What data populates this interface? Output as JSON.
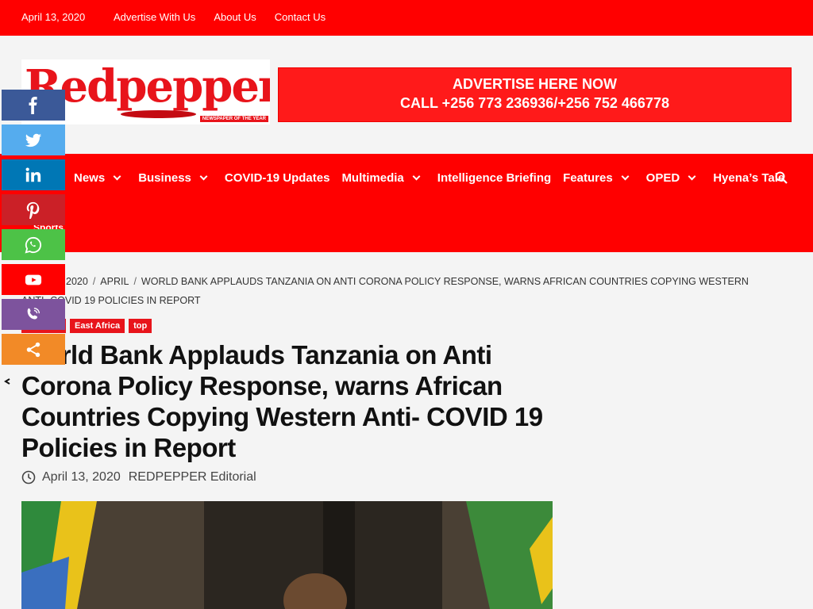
{
  "topbar": {
    "date": "April 13, 2020",
    "links": [
      "Advertise With Us",
      "About Us",
      "Contact Us"
    ]
  },
  "header": {
    "logo_text": "Redpepper",
    "logo_tagline": "NEWSPAPER OF THE YEAR",
    "ad_line1": "ADVERTISE HERE NOW",
    "ad_line2": "CALL +256 773 236936/+256 752 466778"
  },
  "nav": {
    "items": [
      {
        "label": "News",
        "dropdown": true
      },
      {
        "label": "Business",
        "dropdown": true
      },
      {
        "label": "COVID-19 Updates",
        "dropdown": false
      },
      {
        "label": "Multimedia",
        "dropdown": true
      },
      {
        "label": "Intelligence Briefing",
        "dropdown": false
      },
      {
        "label": "Features",
        "dropdown": true
      },
      {
        "label": "OPED",
        "dropdown": true
      },
      {
        "label": "Hyena’s Tale",
        "dropdown": false
      }
    ],
    "sports": "Sports"
  },
  "breadcrumb": {
    "year": "2020",
    "month": "APRIL",
    "current": "WORLD BANK APPLAUDS TANZANIA ON ANTI CORONA POLICY RESPONSE, WARNS AFRICAN COUNTRIES COPYING WESTERN ANTI- COVID 19 POLICIES IN REPORT"
  },
  "article": {
    "tags": [
      "East Africa",
      "top"
    ],
    "title": "World Bank Applauds Tanzania on Anti Corona Policy Response, warns African Countries Copying Western Anti- COVID 19 Policies in Report",
    "date": "April 13, 2020",
    "author": "REDPEPPER Editorial"
  },
  "share_buttons": [
    {
      "name": "facebook",
      "color": "#3b5998"
    },
    {
      "name": "twitter",
      "color": "#55acee"
    },
    {
      "name": "linkedin",
      "color": "#0077b5"
    },
    {
      "name": "pinterest",
      "color": "#cb2027"
    },
    {
      "name": "whatsapp",
      "color": "#4dc247"
    },
    {
      "name": "youtube",
      "color": "#ff0000"
    },
    {
      "name": "viber",
      "color": "#7d539d"
    },
    {
      "name": "more",
      "color": "#f28a27"
    }
  ],
  "colors": {
    "brand_red": "#ff0000"
  }
}
